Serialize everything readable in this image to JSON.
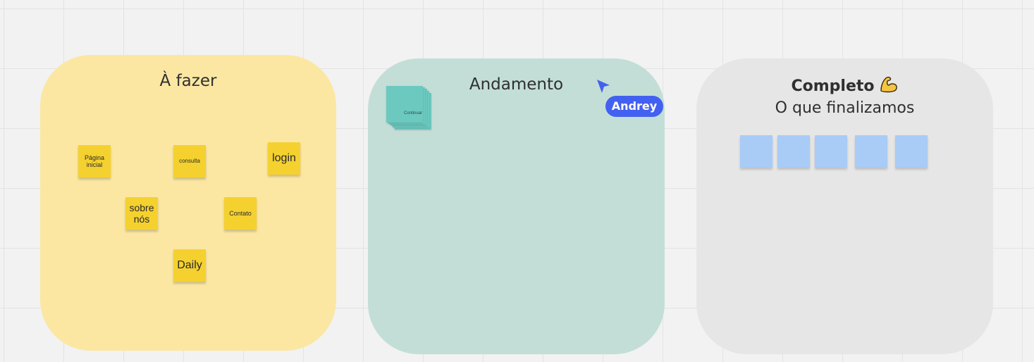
{
  "boards": {
    "todo": {
      "title": "À fazer",
      "notes": {
        "pagina_inicial": {
          "line1": "Página",
          "line2": "inicial"
        },
        "consulta": "consulta",
        "login": "login",
        "sobre_nos": {
          "line1": "sobre",
          "line2": "nós"
        },
        "contato": "Contato",
        "daily": "Daily"
      }
    },
    "progress": {
      "title": "Andamento",
      "stack_label": "Continuar"
    },
    "done": {
      "title": "Completo",
      "subtitle": "O que finalizamos",
      "title_icon": "flexed-biceps-icon",
      "blue_note_count": 5
    }
  },
  "collaborator": {
    "name": "Andrey",
    "color": "#4361f0"
  },
  "colors": {
    "todo_board": "#fbe7a2",
    "progress_board": "#c3ded7",
    "done_board": "#e6e6e6",
    "yellow_note": "#f5d12f",
    "teal_note": "#6cc9bf",
    "blue_note": "#a8ccf6"
  }
}
